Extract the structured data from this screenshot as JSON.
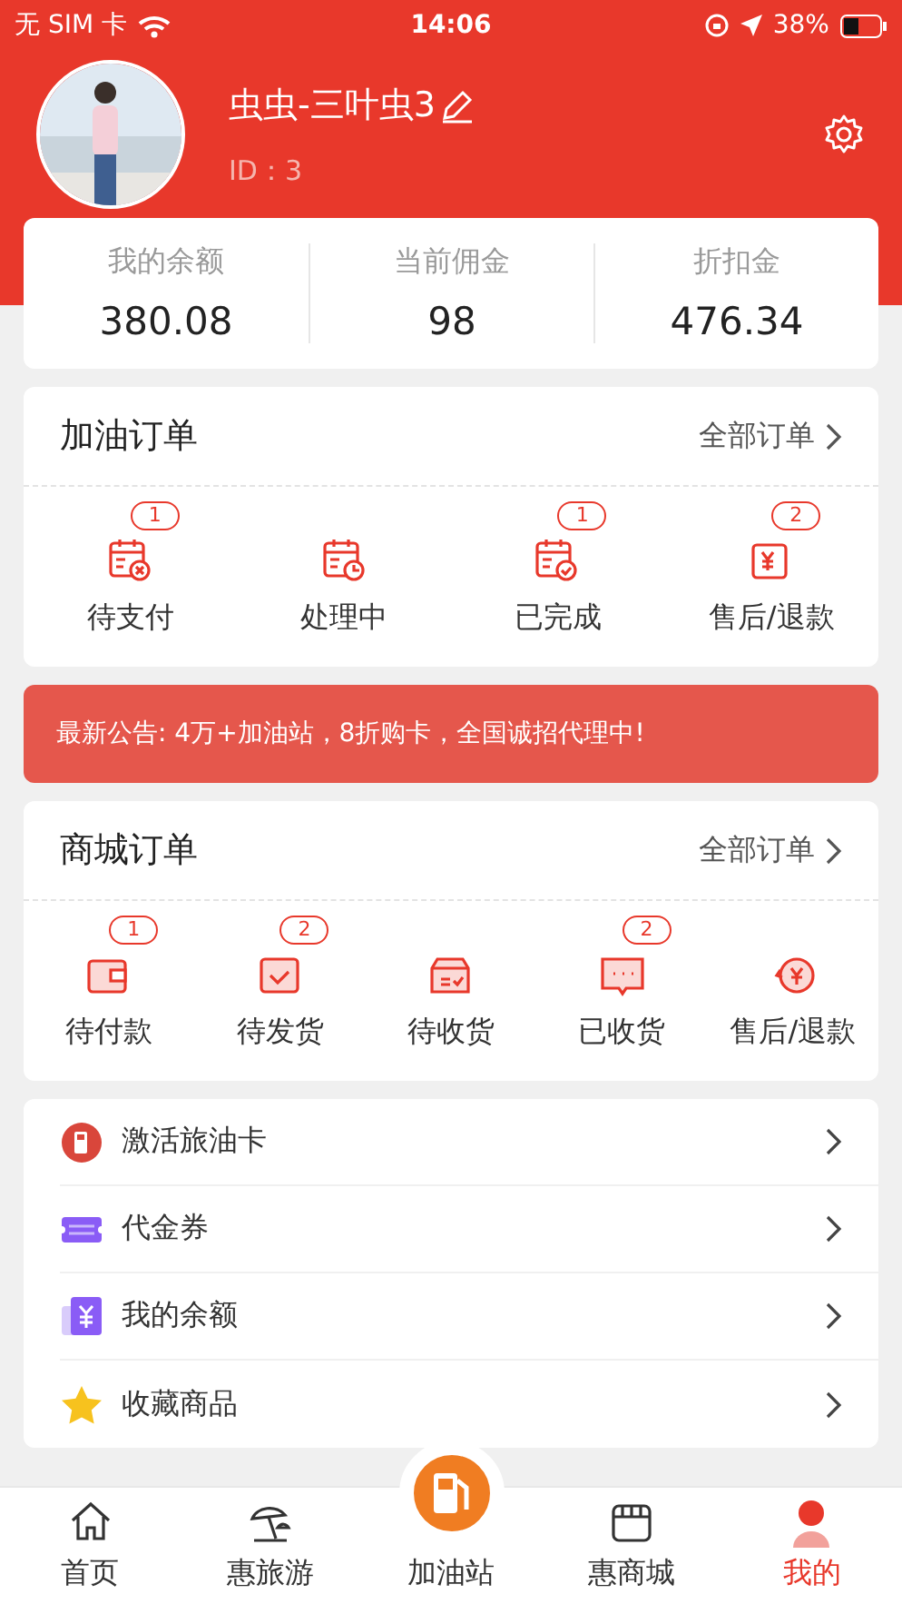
{
  "status_bar": {
    "carrier": "无 SIM 卡",
    "time": "14:06",
    "battery": "38%"
  },
  "profile": {
    "name": "虫虫-三叶虫3",
    "id": "ID：3"
  },
  "stats": [
    {
      "label": "我的余额",
      "value": "380.08"
    },
    {
      "label": "当前佣金",
      "value": "98"
    },
    {
      "label": "折扣金",
      "value": "476.34"
    }
  ],
  "fuel_orders": {
    "title": "加油订单",
    "link": "全部订单",
    "items": [
      {
        "label": "待支付",
        "kind": "cancel",
        "badge": "1"
      },
      {
        "label": "处理中",
        "kind": "clock"
      },
      {
        "label": "已完成",
        "kind": "check",
        "badge": "1"
      },
      {
        "label": "售后/退款",
        "kind": "yen",
        "badge": "2"
      }
    ]
  },
  "notice": "最新公告: 4万+加油站，8折购卡，全国诚招代理中!",
  "mall_orders": {
    "title": "商城订单",
    "link": "全部订单",
    "items": [
      {
        "label": "待付款",
        "kind": "wallet",
        "badge": "1"
      },
      {
        "label": "待发货",
        "kind": "checkbox",
        "badge": "2"
      },
      {
        "label": "待收货",
        "kind": "box"
      },
      {
        "label": "已收货",
        "kind": "chat",
        "badge": "2"
      },
      {
        "label": "售后/退款",
        "kind": "refund"
      }
    ]
  },
  "menu": [
    {
      "label": "激活旅油卡",
      "kind": "fuel"
    },
    {
      "label": "代金券",
      "kind": "ticket"
    },
    {
      "label": "我的余额",
      "kind": "yen"
    },
    {
      "label": "收藏商品",
      "kind": "star"
    }
  ],
  "tabs": [
    {
      "label": "首页",
      "kind": "home",
      "selected": false
    },
    {
      "label": "惠旅游",
      "kind": "beach",
      "selected": false
    },
    {
      "label": "加油站",
      "kind": "fuel",
      "selected": false
    },
    {
      "label": "惠商城",
      "kind": "shop",
      "selected": false
    },
    {
      "label": "我的",
      "kind": "user",
      "selected": true
    }
  ]
}
